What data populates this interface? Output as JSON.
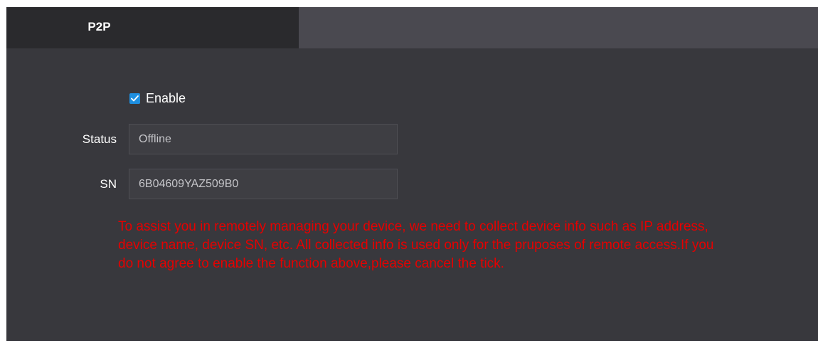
{
  "tabs": [
    {
      "label": "P2P",
      "active": true
    }
  ],
  "form": {
    "enable": {
      "label": "Enable",
      "checked": true
    },
    "status": {
      "label": "Status",
      "value": "Offline"
    },
    "sn": {
      "label": "SN",
      "value": "6B04609YAZ509B0"
    }
  },
  "notice": "To assist you in remotely managing your device, we need to collect device info such as IP address, device name, device SN, etc. All collected info is used only for the pruposes of remote access.If you do not agree to enable the function above,please cancel the tick.",
  "colors": {
    "panel_bg": "#38383d",
    "active_tab_bg": "#2a2a2d",
    "tabbar_bg": "#4a4950",
    "accent": "#1e8fe0",
    "notice_text": "#e60000"
  }
}
